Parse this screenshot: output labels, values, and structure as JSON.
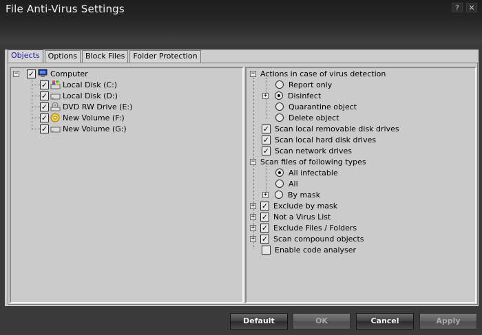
{
  "window": {
    "title": "File Anti-Virus Settings",
    "help_glyph": "?",
    "close_glyph": "✕"
  },
  "tabs": [
    "Objects",
    "Options",
    "Block Files",
    "Folder Protection"
  ],
  "tree": {
    "root": "Computer",
    "items": [
      {
        "label": "Local Disk (C:)",
        "icon": "windows-drive-icon"
      },
      {
        "label": "Local Disk (D:)",
        "icon": "hard-drive-icon"
      },
      {
        "label": "DVD RW Drive (E:)",
        "icon": "dvd-drive-icon"
      },
      {
        "label": "New Volume (F:)",
        "icon": "cd-disc-icon"
      },
      {
        "label": "New Volume (G:)",
        "icon": "hard-drive-icon"
      }
    ]
  },
  "options": {
    "actions_header": "Actions in case of virus detection",
    "actions": [
      "Report only",
      "Disinfect",
      "Quarantine object",
      "Delete object"
    ],
    "actions_selected": "Disinfect",
    "scan_removable": "Scan local removable disk drives",
    "scan_hard": "Scan local hard disk drives",
    "scan_network": "Scan network drives",
    "filetypes_header": "Scan files of following types",
    "filetypes": [
      "All infectable",
      "All",
      "By mask"
    ],
    "filetypes_selected": "All infectable",
    "exclude_mask": "Exclude by mask",
    "not_virus": "Not a Virus List",
    "exclude_files": "Exclude Files / Folders",
    "scan_compound": "Scan compound objects",
    "code_analyser": "Enable code analyser"
  },
  "buttons": {
    "default": "Default",
    "ok": "OK",
    "cancel": "Cancel",
    "apply": "Apply"
  }
}
